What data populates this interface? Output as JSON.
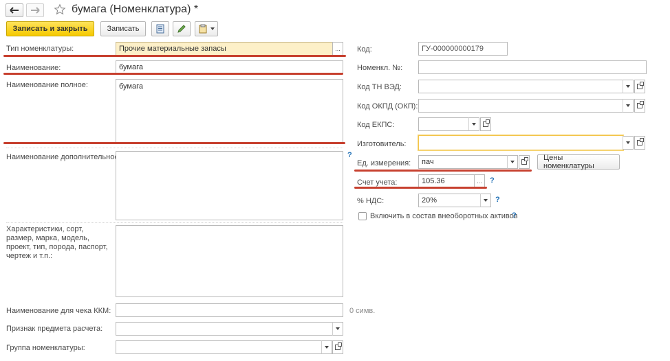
{
  "window": {
    "title": "бумага (Номенклатура) *",
    "back_icon": "arrow-left",
    "forward_icon": "arrow-right",
    "star_icon": "star-outline"
  },
  "toolbar": {
    "save_close_label": "Записать и закрыть",
    "save_label": "Записать",
    "accent": "#f5c900"
  },
  "left": {
    "type_label": "Тип номенклатуры:",
    "type_value": "Прочие материальные запасы",
    "name_label": "Наименование:",
    "name_value": "бумага",
    "full_name_label": "Наименование полное:",
    "full_name_value": "бумага",
    "additional_name_label": "Наименование дополнительное:",
    "characteristics_label": "Характеристики, сорт, размер, марка, модель, проект, тип, порода, паспорт, чертеж и т.п.:",
    "kkm_label": "Наименование для чека ККМ:",
    "kkm_counter": "0 симв.",
    "payment_subject_label": "Признак предмета расчета:",
    "group_label": "Группа номенклатуры:",
    "help": "?"
  },
  "right": {
    "code_label": "Код:",
    "code_value": "ГУ-000000000179",
    "nomencl_no_label": "Номенкл. №:",
    "tn_ved_label": "Код ТН ВЭД:",
    "okpd_label": "Код ОКПД (ОКП):",
    "ekps_label": "Код ЕКПС:",
    "manufacturer_label": "Изготовитель:",
    "unit_label": "Ед. измерения:",
    "unit_value": "пач",
    "prices_button": "Цены номенклатуры",
    "account_label": "Счет учета:",
    "account_value": "105.36",
    "vat_label": "% НДС:",
    "vat_value": "20%",
    "noncurrent_label": "Включить в состав внеоборотных активов",
    "help": "?",
    "ellipsis": "..."
  },
  "colors": {
    "annotation_red": "#c7402f",
    "highlight_field": "#fdf0c8",
    "help_blue": "#1f6fb5"
  }
}
